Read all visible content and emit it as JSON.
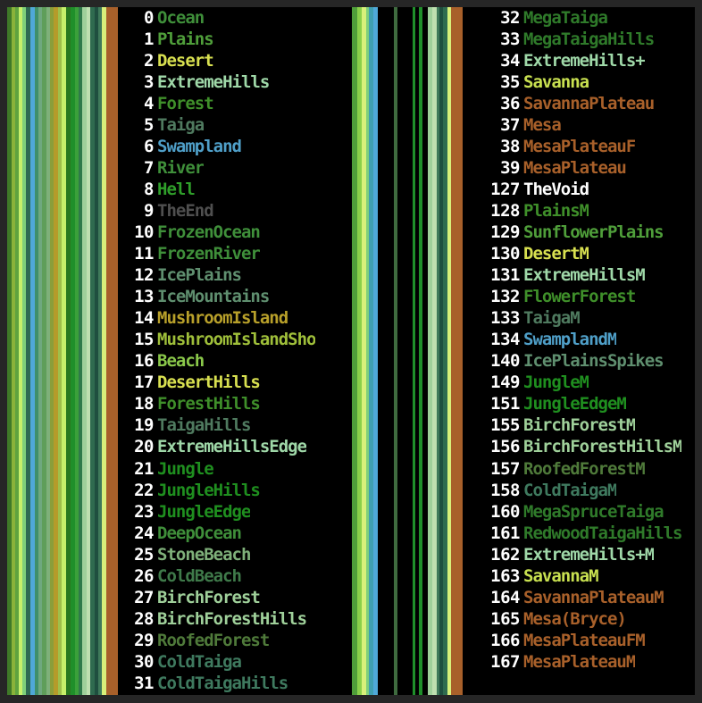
{
  "meta": {
    "background": "#262626",
    "panel_background": "#000000",
    "index_color": "#ffffff"
  },
  "stripes_left": [
    {
      "color": "#3f7a28",
      "width": 5
    },
    {
      "color": "#8ab33a",
      "width": 4
    },
    {
      "color": "#5fa33f",
      "width": 4
    },
    {
      "color": "#c8f06a",
      "width": 4
    },
    {
      "color": "#7fd07a",
      "width": 4
    },
    {
      "color": "#2f6b52",
      "width": 5
    },
    {
      "color": "#4fa8d8",
      "width": 5
    },
    {
      "color": "#3f8f6a",
      "width": 4
    },
    {
      "color": "#6fa87f",
      "width": 4
    },
    {
      "color": "#5f9e5a",
      "width": 5
    },
    {
      "color": "#7fb07a",
      "width": 4
    },
    {
      "color": "#8a9e3a",
      "width": 4
    },
    {
      "color": "#b59b2a",
      "width": 5
    },
    {
      "color": "#9fbf4a",
      "width": 4
    },
    {
      "color": "#c8f06a",
      "width": 5
    },
    {
      "color": "#2a7a1f",
      "width": 4
    },
    {
      "color": "#1f8f2a",
      "width": 5
    },
    {
      "color": "#3aa03a",
      "width": 4
    },
    {
      "color": "#2f7a4a",
      "width": 4
    },
    {
      "color": "#9fd09a",
      "width": 5
    },
    {
      "color": "#bfe0b0",
      "width": 4
    },
    {
      "color": "#2f6b4f",
      "width": 5
    },
    {
      "color": "#1f4f3f",
      "width": 4
    },
    {
      "color": "#3f7a5a",
      "width": 4
    },
    {
      "color": "#d8f07a",
      "width": 5
    },
    {
      "color": "#a8602a",
      "width": 13
    }
  ],
  "stripes_right": [
    {
      "color": "#000000",
      "width": 4
    },
    {
      "color": "#4f9e3a",
      "width": 7
    },
    {
      "color": "#8ad04a",
      "width": 5
    },
    {
      "color": "#d8f07a",
      "width": 5
    },
    {
      "color": "#7fcf7a",
      "width": 4
    },
    {
      "color": "#3f9fb0",
      "width": 5
    },
    {
      "color": "#4fa8d8",
      "width": 5
    },
    {
      "color": "#000000",
      "width": 20
    },
    {
      "color": "#3f6b3f",
      "width": 4
    },
    {
      "color": "#000000",
      "width": 18
    },
    {
      "color": "#1f8f2a",
      "width": 4
    },
    {
      "color": "#000000",
      "width": 4
    },
    {
      "color": "#1f8f2a",
      "width": 4
    },
    {
      "color": "#000000",
      "width": 7
    },
    {
      "color": "#9fd09a",
      "width": 5
    },
    {
      "color": "#bfe0b0",
      "width": 5
    },
    {
      "color": "#3f7a5a",
      "width": 4
    },
    {
      "color": "#1f4f3f",
      "width": 4
    },
    {
      "color": "#2f6b4f",
      "width": 5
    },
    {
      "color": "#d8f07a",
      "width": 5
    },
    {
      "color": "#a8602a",
      "width": 14
    },
    {
      "color": "#000000",
      "width": 6
    }
  ],
  "columns": {
    "left": [
      {
        "id": "0",
        "name": "Ocean",
        "color": "#3f8f3a"
      },
      {
        "id": "1",
        "name": "Plains",
        "color": "#4f9e3a"
      },
      {
        "id": "2",
        "name": "Desert",
        "color": "#d8e050"
      },
      {
        "id": "3",
        "name": "ExtremeHills",
        "color": "#9fd8a8"
      },
      {
        "id": "4",
        "name": "Forest",
        "color": "#3f8f2a"
      },
      {
        "id": "5",
        "name": "Taiga",
        "color": "#4f7a5f"
      },
      {
        "id": "6",
        "name": "Swampland",
        "color": "#4f9fc8"
      },
      {
        "id": "7",
        "name": "River",
        "color": "#3f8f3a"
      },
      {
        "id": "8",
        "name": "Hell",
        "color": "#2f9e2a"
      },
      {
        "id": "9",
        "name": "TheEnd",
        "color": "#4f4f4f"
      },
      {
        "id": "10",
        "name": "FrozenOcean",
        "color": "#3f8f3a"
      },
      {
        "id": "11",
        "name": "FrozenRiver",
        "color": "#3f8f3a"
      },
      {
        "id": "12",
        "name": "IcePlains",
        "color": "#5f8f6f"
      },
      {
        "id": "13",
        "name": "IceMountains",
        "color": "#5f8f6f"
      },
      {
        "id": "14",
        "name": "MushroomIsland",
        "color": "#b8a02a"
      },
      {
        "id": "15",
        "name": "MushroomIslandSho",
        "color": "#9fbf3a"
      },
      {
        "id": "16",
        "name": "Beach",
        "color": "#8ac84a"
      },
      {
        "id": "17",
        "name": "DesertHills",
        "color": "#d8e050"
      },
      {
        "id": "18",
        "name": "ForestHills",
        "color": "#3f8f2a"
      },
      {
        "id": "19",
        "name": "TaigaHills",
        "color": "#4f7a5f"
      },
      {
        "id": "20",
        "name": "ExtremeHillsEdge",
        "color": "#9fd8a8"
      },
      {
        "id": "21",
        "name": "Jungle",
        "color": "#1f8f1f"
      },
      {
        "id": "22",
        "name": "JungleHills",
        "color": "#1f8f1f"
      },
      {
        "id": "23",
        "name": "JungleEdge",
        "color": "#1f8f1f"
      },
      {
        "id": "24",
        "name": "DeepOcean",
        "color": "#3f8f3a"
      },
      {
        "id": "25",
        "name": "StoneBeach",
        "color": "#7fb07a"
      },
      {
        "id": "26",
        "name": "ColdBeach",
        "color": "#3f7a4a"
      },
      {
        "id": "27",
        "name": "BirchForest",
        "color": "#9fd09a"
      },
      {
        "id": "28",
        "name": "BirchForestHills",
        "color": "#9fd09a"
      },
      {
        "id": "29",
        "name": "RoofedForest",
        "color": "#4f7a3a"
      },
      {
        "id": "30",
        "name": "ColdTaiga",
        "color": "#3f7a5f"
      },
      {
        "id": "31",
        "name": "ColdTaigaHills",
        "color": "#3f7a5f"
      }
    ],
    "right": [
      {
        "id": "32",
        "name": "MegaTaiga",
        "color": "#2f7a2a"
      },
      {
        "id": "33",
        "name": "MegaTaigaHills",
        "color": "#2f7a2a"
      },
      {
        "id": "34",
        "name": "ExtremeHills+",
        "color": "#9fd8a8"
      },
      {
        "id": "35",
        "name": "Savanna",
        "color": "#c8e050"
      },
      {
        "id": "36",
        "name": "SavannaPlateau",
        "color": "#a8602a"
      },
      {
        "id": "37",
        "name": "Mesa",
        "color": "#a8602a"
      },
      {
        "id": "38",
        "name": "MesaPlateauF",
        "color": "#a8602a"
      },
      {
        "id": "39",
        "name": "MesaPlateau",
        "color": "#a8602a"
      },
      {
        "id": "127",
        "name": "TheVoid",
        "color": "#ffffff"
      },
      {
        "id": "128",
        "name": "PlainsM",
        "color": "#3f8f2a"
      },
      {
        "id": "129",
        "name": "SunflowerPlains",
        "color": "#4f9e3a"
      },
      {
        "id": "130",
        "name": "DesertM",
        "color": "#d8e050"
      },
      {
        "id": "131",
        "name": "ExtremeHillsM",
        "color": "#9fd8a8"
      },
      {
        "id": "132",
        "name": "FlowerForest",
        "color": "#3f8f2a"
      },
      {
        "id": "133",
        "name": "TaigaM",
        "color": "#4f7a5f"
      },
      {
        "id": "134",
        "name": "SwamplandM",
        "color": "#4f9fc8"
      },
      {
        "id": "140",
        "name": "IcePlainsSpikes",
        "color": "#5f8f6f"
      },
      {
        "id": "149",
        "name": "JungleM",
        "color": "#1f8f1f"
      },
      {
        "id": "151",
        "name": "JungleEdgeM",
        "color": "#1f8f1f"
      },
      {
        "id": "155",
        "name": "BirchForestM",
        "color": "#9fd09a"
      },
      {
        "id": "156",
        "name": "BirchForestHillsM",
        "color": "#9fd09a"
      },
      {
        "id": "157",
        "name": "RoofedForestM",
        "color": "#4f7a3a"
      },
      {
        "id": "158",
        "name": "ColdTaigaM",
        "color": "#3f7a5f"
      },
      {
        "id": "160",
        "name": "MegaSpruceTaiga",
        "color": "#2f7a2a"
      },
      {
        "id": "161",
        "name": "RedwoodTaigaHills",
        "color": "#2f7a2a"
      },
      {
        "id": "162",
        "name": "ExtremeHills+M",
        "color": "#9fd8a8"
      },
      {
        "id": "163",
        "name": "SavannaM",
        "color": "#c8e050"
      },
      {
        "id": "164",
        "name": "SavannaPlateauM",
        "color": "#a8602a"
      },
      {
        "id": "165",
        "name": "Mesa(Bryce)",
        "color": "#a8602a"
      },
      {
        "id": "166",
        "name": "MesaPlateauFM",
        "color": "#a8602a"
      },
      {
        "id": "167",
        "name": "MesaPlateauM",
        "color": "#a8602a"
      }
    ]
  }
}
